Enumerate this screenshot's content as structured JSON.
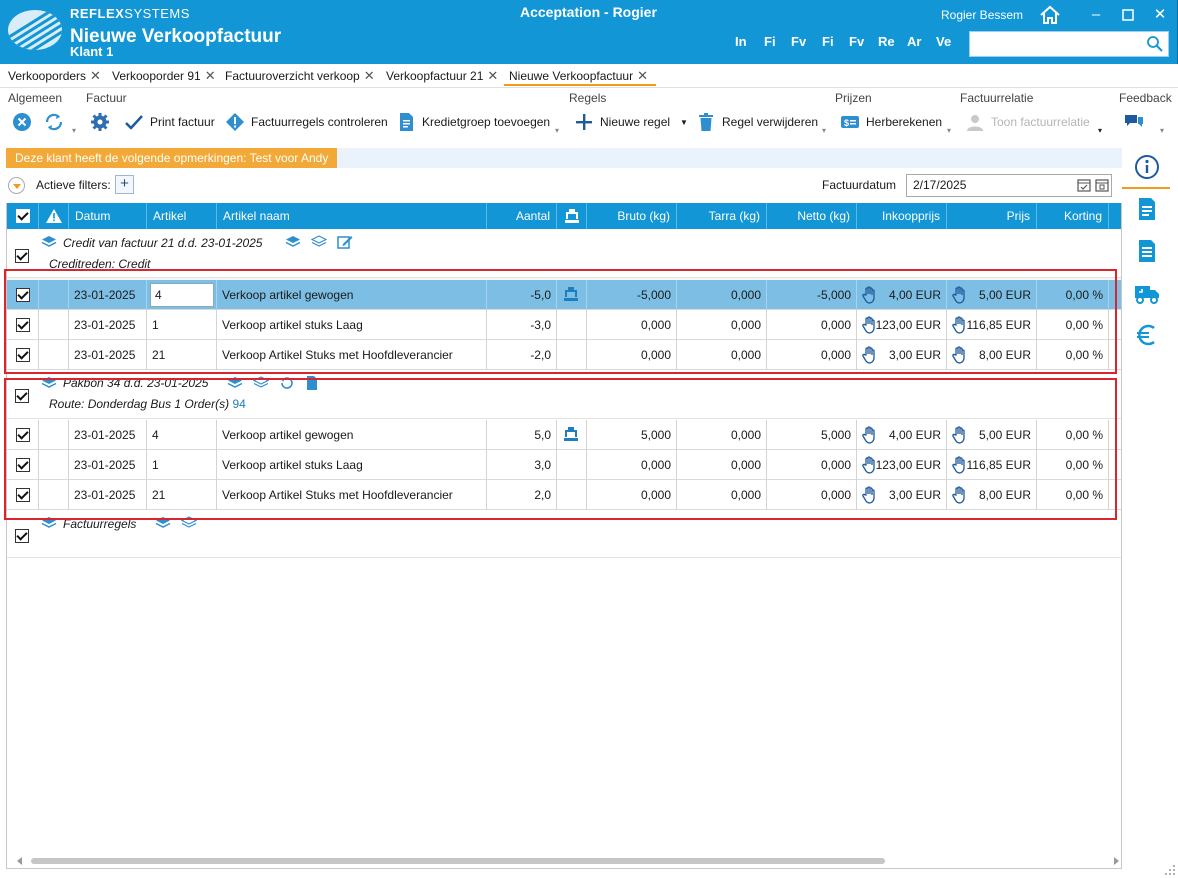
{
  "app": {
    "brand_bold": "REFLEX",
    "brand_light": "SYSTEMS",
    "window_title": "Nieuwe Verkoopfactuur",
    "window_subtitle": "Klant 1",
    "environment_title": "Acceptation - Rogier",
    "user_name": "Rogier Bessem",
    "quick_links": [
      "In",
      "Fi",
      "Fv",
      "Fi",
      "Fv",
      "Re",
      "Ar",
      "Ve"
    ],
    "search_placeholder": ""
  },
  "tabs": [
    {
      "label": "Verkooporders",
      "active": false
    },
    {
      "label": "Verkooporder 91",
      "active": false
    },
    {
      "label": "Factuuroverzicht verkoop",
      "active": false
    },
    {
      "label": "Verkoopfactuur 21",
      "active": false
    },
    {
      "label": "Nieuwe Verkoopfactuur",
      "active": true
    }
  ],
  "ribbon": {
    "groups": {
      "algemeen": "Algemeen",
      "factuur": "Factuur",
      "regels": "Regels",
      "prijzen": "Prijzen",
      "factuurrelatie": "Factuurrelatie",
      "feedback": "Feedback"
    },
    "buttons": {
      "print": "Print factuur",
      "check": "Factuurregels controleren",
      "credit_group": "Kredietgroep toevoegen",
      "new_line": "Nieuwe regel",
      "delete_line": "Regel verwijderen",
      "recalc": "Herberekenen",
      "show_relation": "Toon factuurrelatie"
    }
  },
  "banner": "Deze klant heeft de volgende opmerkingen: Test voor Andy",
  "filters": {
    "label": "Actieve filters:",
    "add": "+",
    "date_label": "Factuurdatum",
    "date_value": "2/17/2025"
  },
  "columns": {
    "datum": "Datum",
    "artikel": "Artikel",
    "artikel_naam": "Artikel naam",
    "aantal": "Aantal",
    "bruto": "Bruto (kg)",
    "tarra": "Tarra (kg)",
    "netto": "Netto (kg)",
    "inkoopprijs": "Inkoopprijs",
    "prijs": "Prijs",
    "korting": "Korting"
  },
  "groups": [
    {
      "title": "Credit van factuur 21  d.d.  23-01-2025",
      "subtitle": "Creditreden:   Credit",
      "rows": [
        {
          "datum": "23-01-2025",
          "artikel": "4",
          "naam": "Verkoop artikel gewogen",
          "aantal": "-5,0",
          "scale": true,
          "bruto": "-5,000",
          "tarra": "0,000",
          "netto": "-5,000",
          "inkoop": "4,00 EUR",
          "prijs": "5,00 EUR",
          "korting": "0,00 %",
          "selected": true
        },
        {
          "datum": "23-01-2025",
          "artikel": "1",
          "naam": "Verkoop artikel stuks Laag",
          "aantal": "-3,0",
          "scale": false,
          "bruto": "0,000",
          "tarra": "0,000",
          "netto": "0,000",
          "inkoop": "123,00 EUR",
          "prijs": "116,85 EUR",
          "korting": "0,00 %",
          "selected": false
        },
        {
          "datum": "23-01-2025",
          "artikel": "21",
          "naam": "Verkoop Artikel Stuks met Hoofdleverancier",
          "aantal": "-2,0",
          "scale": false,
          "bruto": "0,000",
          "tarra": "0,000",
          "netto": "0,000",
          "inkoop": "3,00 EUR",
          "prijs": "8,00 EUR",
          "korting": "0,00 %",
          "selected": false
        }
      ]
    },
    {
      "title": "Pakbon 34  d.d.  23-01-2025",
      "subtitle": "Route:  Donderdag Bus 1  Order(s)",
      "subtitle_link": "94",
      "rows": [
        {
          "datum": "23-01-2025",
          "artikel": "4",
          "naam": "Verkoop artikel gewogen",
          "aantal": "5,0",
          "scale": true,
          "bruto": "5,000",
          "tarra": "0,000",
          "netto": "5,000",
          "inkoop": "4,00 EUR",
          "prijs": "5,00 EUR",
          "korting": "0,00 %",
          "selected": false
        },
        {
          "datum": "23-01-2025",
          "artikel": "1",
          "naam": "Verkoop artikel stuks Laag",
          "aantal": "3,0",
          "scale": false,
          "bruto": "0,000",
          "tarra": "0,000",
          "netto": "0,000",
          "inkoop": "123,00 EUR",
          "prijs": "116,85 EUR",
          "korting": "0,00 %",
          "selected": false
        },
        {
          "datum": "23-01-2025",
          "artikel": "21",
          "naam": "Verkoop Artikel Stuks met Hoofdleverancier",
          "aantal": "2,0",
          "scale": false,
          "bruto": "0,000",
          "tarra": "0,000",
          "netto": "0,000",
          "inkoop": "3,00 EUR",
          "prijs": "8,00 EUR",
          "korting": "0,00 %",
          "selected": false
        }
      ]
    },
    {
      "title": "Factuurregels",
      "rows": []
    }
  ],
  "side_panel": [
    "info-icon",
    "document-icon",
    "document-list-icon",
    "truck-icon",
    "euro-icon"
  ],
  "colors": {
    "accent": "#1296d6",
    "highlight_orange": "#f29a1c",
    "banner": "#f3a937",
    "selected_row": "#7dbfe4",
    "annotation_red": "#d9262c"
  }
}
